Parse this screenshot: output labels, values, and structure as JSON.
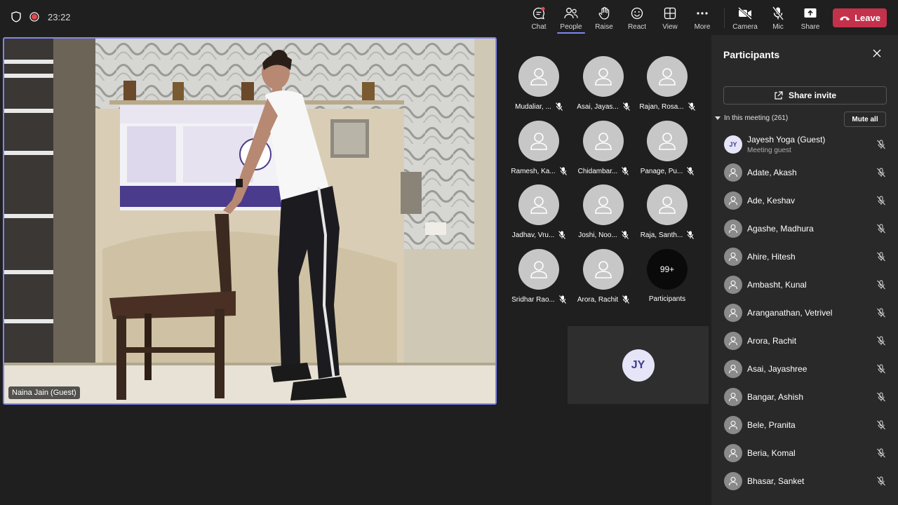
{
  "topbar": {
    "timer": "23:22",
    "buttons": [
      {
        "key": "chat",
        "label": "Chat",
        "icon": "chat-icon"
      },
      {
        "key": "people",
        "label": "People",
        "icon": "people-icon"
      },
      {
        "key": "raise",
        "label": "Raise",
        "icon": "raise-hand-icon"
      },
      {
        "key": "react",
        "label": "React",
        "icon": "react-icon"
      },
      {
        "key": "view",
        "label": "View",
        "icon": "view-icon"
      },
      {
        "key": "more",
        "label": "More",
        "icon": "more-icon"
      },
      {
        "key": "camera",
        "label": "Camera",
        "icon": "camera-off-icon"
      },
      {
        "key": "mic",
        "label": "Mic",
        "icon": "mic-off-icon"
      },
      {
        "key": "share",
        "label": "Share",
        "icon": "share-icon"
      }
    ],
    "leave_label": "Leave"
  },
  "main_video": {
    "name": "Naina Jain (Guest)"
  },
  "gallery": {
    "tiles": [
      {
        "name": "Mudaliar, ..."
      },
      {
        "name": "Asai, Jayas..."
      },
      {
        "name": "Rajan, Rosa..."
      },
      {
        "name": "Ramesh, Ka..."
      },
      {
        "name": "Chidambar..."
      },
      {
        "name": "Panage, Pu..."
      },
      {
        "name": "Jadhav, Vru..."
      },
      {
        "name": "Joshi, Noo..."
      },
      {
        "name": "Raja, Santh..."
      },
      {
        "name": "Sridhar Rao..."
      },
      {
        "name": "Arora, Rachit"
      }
    ],
    "overflow_count": "99+",
    "overflow_label": "Participants",
    "self_initials": "JY"
  },
  "panel": {
    "title": "Participants",
    "share_invite_label": "Share invite",
    "in_meeting_label": "In this meeting (261)",
    "mute_all_label": "Mute all",
    "participants": [
      {
        "name": "Jayesh Yoga (Guest)",
        "subtitle": "Meeting guest",
        "initials": "JY"
      },
      {
        "name": "Adate, Akash"
      },
      {
        "name": "Ade, Keshav"
      },
      {
        "name": "Agashe, Madhura"
      },
      {
        "name": "Ahire, Hitesh"
      },
      {
        "name": "Ambasht, Kunal"
      },
      {
        "name": "Aranganathan, Vetrivel"
      },
      {
        "name": "Arora, Rachit"
      },
      {
        "name": "Asai, Jayashree"
      },
      {
        "name": "Bangar, Ashish"
      },
      {
        "name": "Bele, Pranita"
      },
      {
        "name": "Beria, Komal"
      },
      {
        "name": "Bhasar, Sanket"
      }
    ]
  },
  "colors": {
    "accent": "#7f85f5",
    "leave": "#c4314b",
    "record": "#e5484d",
    "background": "#1f1f1f",
    "panel": "#292929"
  }
}
